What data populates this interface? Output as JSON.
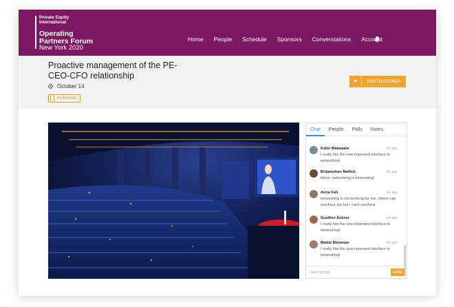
{
  "header": {
    "brand": "Private Equity\nInternational",
    "event_line1": "Operating",
    "event_line2": "Partners Forum",
    "event_line3": "New York 2020",
    "nav": [
      "Home",
      "People",
      "Schedule",
      "Sponsors",
      "Converstations",
      "Account"
    ],
    "bell_icon": "bell-icon"
  },
  "session": {
    "title": "Proactive management of the PE-CEO-CFO relationship",
    "date": "October 14",
    "tag": "BRANDING",
    "agenda_plus": "+",
    "agenda_label": "ADD TO AGENDA"
  },
  "chat": {
    "tabs": [
      "Chat",
      "People",
      "Polls",
      "Notes"
    ],
    "active_tab": "Chat",
    "messages": [
      {
        "name": "Kaito Watanabe",
        "time": "6m ago",
        "text": "I really like the new improved interface in networking!"
      },
      {
        "name": "Brijamohan Mallick",
        "time": "6m ago",
        "text": "Hmm, networking is interesting!"
      },
      {
        "name": "Anna Fali",
        "time": "6m ago",
        "text": "networking is not working for me. others can see/hear me but I can't see/hear"
      },
      {
        "name": "Gunther Ackner",
        "time": "3m ago",
        "text": "I really like the new improved interface in networking!"
      },
      {
        "name": "Mattie Blooman",
        "time": "3m ago",
        "text": "I really like the new improved interface in networking!"
      }
    ],
    "placeholder": "Start typing",
    "send_label": "SEND"
  },
  "colors": {
    "header": "#7b1763",
    "accent": "#f1a531",
    "tab_active": "#3a8fd9"
  }
}
